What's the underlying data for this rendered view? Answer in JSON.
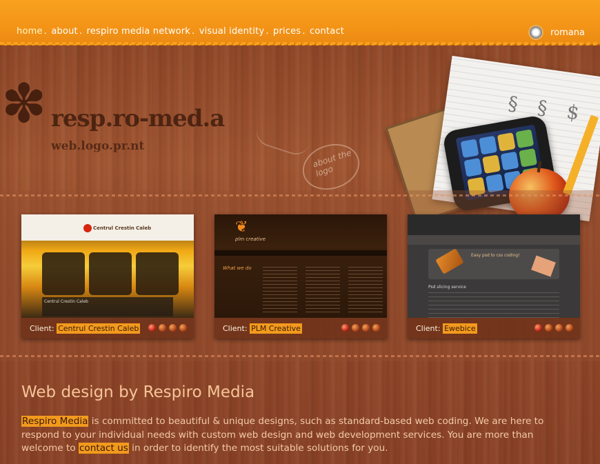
{
  "nav": {
    "items": [
      "home",
      "about",
      "respiro media network",
      "visual identity",
      "prices",
      "contact"
    ],
    "separator": ".",
    "language": "romana"
  },
  "logo": {
    "name": "resp.ro-med.a",
    "subtitle": "web.logo.pr.nt",
    "about_note": "about the logo"
  },
  "portfolio": {
    "client_label": "Client:",
    "cards": [
      {
        "client": "Centrul Crestin Caleb",
        "screenshot_title": "Centrul Crestin Caleb",
        "screenshot_text": "Centrul Crestin Caleb"
      },
      {
        "client": "PLM Creative",
        "screenshot_title": "plm creative",
        "screenshot_text": "What we do"
      },
      {
        "client": "Ewebice",
        "screenshot_title": "Easy psd to css coding!",
        "screenshot_text": "Psd slicing service"
      }
    ]
  },
  "main": {
    "title": "Web design by Respiro Media",
    "intro_link_1": "Respiro Media",
    "intro_text_1": " is committed to beautiful & unique designs, such as standard-based web coding. We are here to respond to your individual needs with custom web design and web development services. You are more than welcome to ",
    "intro_link_2": "contact us",
    "intro_text_2": " in order to identify the most suitable solutions for you."
  },
  "colors": {
    "accent": "#f39a1d",
    "wood": "#a05531",
    "text": "#f4cba6"
  }
}
